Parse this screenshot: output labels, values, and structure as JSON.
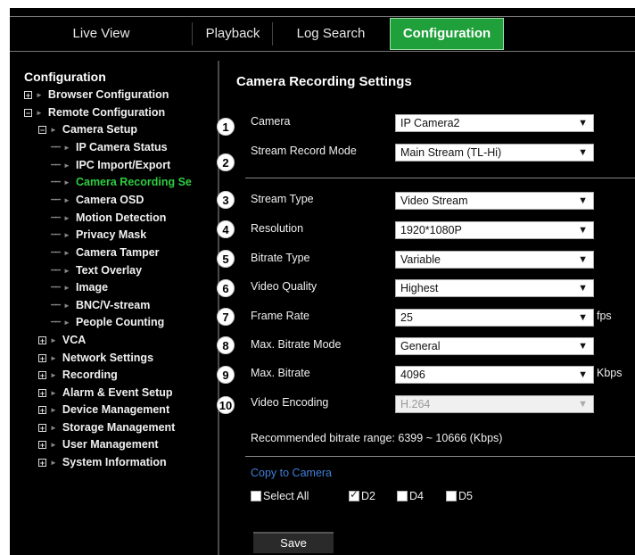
{
  "tabs": [
    {
      "label": "Live View"
    },
    {
      "label": "Playback"
    },
    {
      "label": "Log Search"
    },
    {
      "label": "Configuration"
    }
  ],
  "tree": {
    "title": "Configuration",
    "browser": "Browser Configuration",
    "remote": "Remote Configuration",
    "camera_setup": "Camera Setup",
    "camera_children": [
      "IP Camera Status",
      "IPC Import/Export",
      "Camera Recording Se",
      "Camera OSD",
      "Motion Detection",
      "Privacy Mask",
      "Camera Tamper",
      "Text Overlay",
      "Image",
      "BNC/V-stream",
      "People Counting"
    ],
    "others": [
      "VCA",
      "Network Settings",
      "Recording",
      "Alarm & Event Setup",
      "Device Management",
      "Storage Management",
      "User Management",
      "System Information"
    ]
  },
  "content": {
    "title": "Camera Recording Settings",
    "fields": [
      {
        "num": "1",
        "label": "Camera",
        "value": "IP Camera2"
      },
      {
        "num": "2",
        "label": "Stream Record Mode",
        "value": "Main Stream (TL-Hi)"
      },
      {
        "num": "3",
        "label": "Stream Type",
        "value": "Video Stream"
      },
      {
        "num": "4",
        "label": "Resolution",
        "value": "1920*1080P"
      },
      {
        "num": "5",
        "label": "Bitrate Type",
        "value": "Variable"
      },
      {
        "num": "6",
        "label": "Video Quality",
        "value": "Highest"
      },
      {
        "num": "7",
        "label": "Frame Rate",
        "value": "25",
        "unit": "fps"
      },
      {
        "num": "8",
        "label": "Max. Bitrate Mode",
        "value": "General"
      },
      {
        "num": "9",
        "label": "Max. Bitrate",
        "value": "4096",
        "unit": "Kbps"
      },
      {
        "num": "10",
        "label": "Video Encoding",
        "value": "H.264"
      }
    ],
    "recommended": "Recommended bitrate range: 6399 ~ 10666 (Kbps)",
    "copy_title": "Copy to Camera",
    "checkboxes": [
      {
        "label": "Select All",
        "checked": false
      },
      {
        "label": "D2",
        "checked": true
      },
      {
        "label": "D4",
        "checked": false
      },
      {
        "label": "D5",
        "checked": false
      }
    ],
    "save_label": "Save"
  }
}
